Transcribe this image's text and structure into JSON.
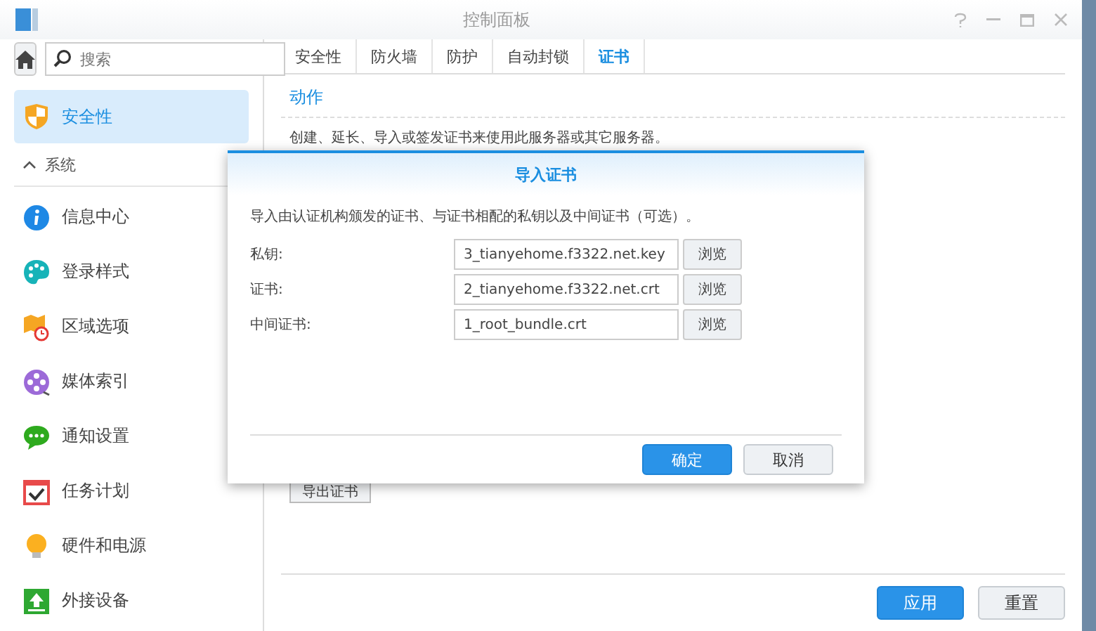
{
  "window": {
    "title": "控制面板"
  },
  "sidebar": {
    "search": {
      "placeholder": "搜索"
    },
    "selected_item": {
      "label": "安全性",
      "selected": true
    },
    "section": {
      "label": "系统",
      "expanded": true
    },
    "items": [
      {
        "label": "信息中心",
        "selected": false
      },
      {
        "label": "登录样式",
        "selected": false
      },
      {
        "label": "区域选项",
        "selected": false
      },
      {
        "label": "媒体索引",
        "selected": false
      },
      {
        "label": "通知设置",
        "selected": false
      },
      {
        "label": "任务计划",
        "selected": false
      },
      {
        "label": "硬件和电源",
        "selected": false
      },
      {
        "label": "外接设备",
        "selected": false
      }
    ]
  },
  "tabs": [
    {
      "label": "安全性",
      "selected": false
    },
    {
      "label": "防火墙",
      "selected": false
    },
    {
      "label": "防护",
      "selected": false
    },
    {
      "label": "自动封锁",
      "selected": false
    },
    {
      "label": "证书",
      "selected": true
    }
  ],
  "content": {
    "heading": "动作",
    "description": "创建、延长、导入或签发证书来使用此服务器或其它服务器。",
    "export_button": "导出证书",
    "buttons": [
      {
        "label": "应用",
        "kind": "primary"
      },
      {
        "label": "重置",
        "kind": "secondary"
      }
    ]
  },
  "dialog": {
    "title": "导入证书",
    "description": "导入由认证机构颁发的证书、与证书相配的私钥以及中间证书（可选）。",
    "fields": [
      {
        "label": "私钥:",
        "value": "3_tianyehome.f3322.net.key",
        "button": "浏览"
      },
      {
        "label": "证书:",
        "value": "2_tianyehome.f3322.net.crt",
        "button": "浏览"
      },
      {
        "label": "中间证书:",
        "value": "1_root_bundle.crt",
        "button": "浏览"
      }
    ],
    "buttons": [
      {
        "label": "确定",
        "kind": "primary"
      },
      {
        "label": "取消",
        "kind": "secondary"
      }
    ]
  }
}
